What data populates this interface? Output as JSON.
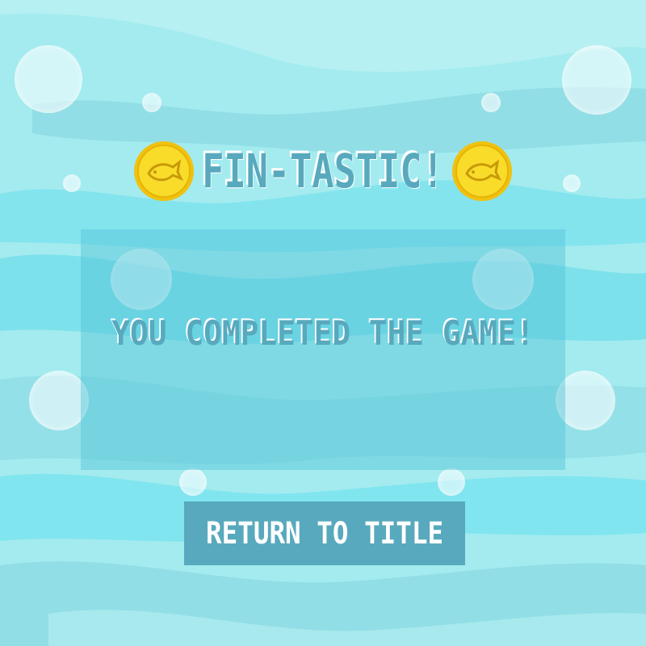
{
  "colors": {
    "background": "#a3ebef",
    "wave_light": "#b9f1f3",
    "wave_dark": "#8ad9e2",
    "wave_bright": "#71e2ee",
    "panel": "#52c3d7",
    "accent": "#58a9bd",
    "coin": "#f7d21b",
    "text_highlight": "#ffffff"
  },
  "header": {
    "title": "FIN-TASTIC!",
    "left_icon": "gold-fish-coin-icon",
    "right_icon": "gold-fish-coin-icon"
  },
  "panel": {
    "message": "YOU COMPLETED THE GAME!"
  },
  "buttons": {
    "return_label": "RETURN TO TITLE"
  }
}
